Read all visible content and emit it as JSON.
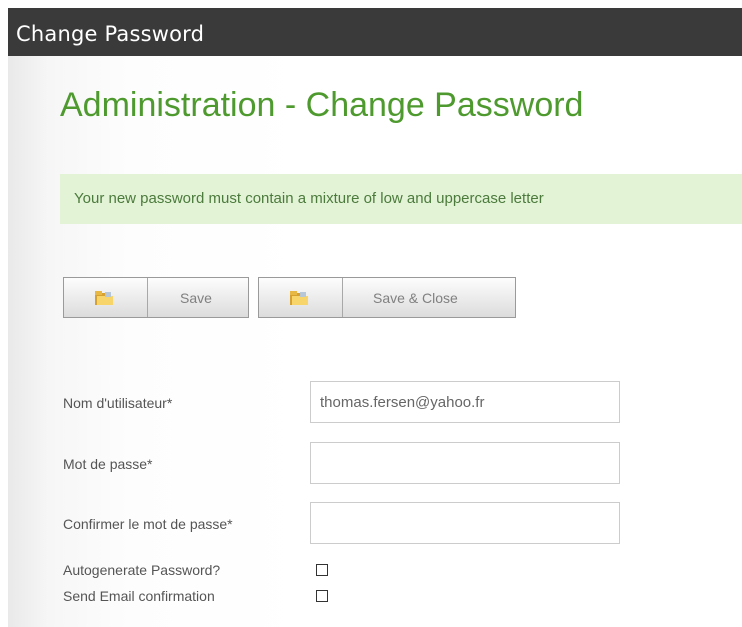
{
  "window": {
    "title": "Change Password"
  },
  "page": {
    "heading": "Administration - Change Password"
  },
  "notice": {
    "message": "Your new password must contain a mixture of low and uppercase letter"
  },
  "toolbar": {
    "save_label": "Save",
    "save_close_label": "Save & Close",
    "save_icon": "folder-icon",
    "save_close_icon": "folder-icon"
  },
  "form": {
    "username_label": "Nom d'utilisateur*",
    "username_value": "thomas.fersen@yahoo.fr",
    "password_label": "Mot de passe*",
    "password_value": "",
    "confirm_label": "Confirmer le mot de passe*",
    "confirm_value": "",
    "autogenerate_label": "Autogenerate Password?",
    "autogenerate_checked": false,
    "send_email_label": "Send Email confirmation",
    "send_email_checked": false
  },
  "colors": {
    "titlebar_bg": "#3a3a3a",
    "heading": "#4e9a2f",
    "notice_bg": "#e2f3d6",
    "notice_text": "#4c7a3c"
  }
}
